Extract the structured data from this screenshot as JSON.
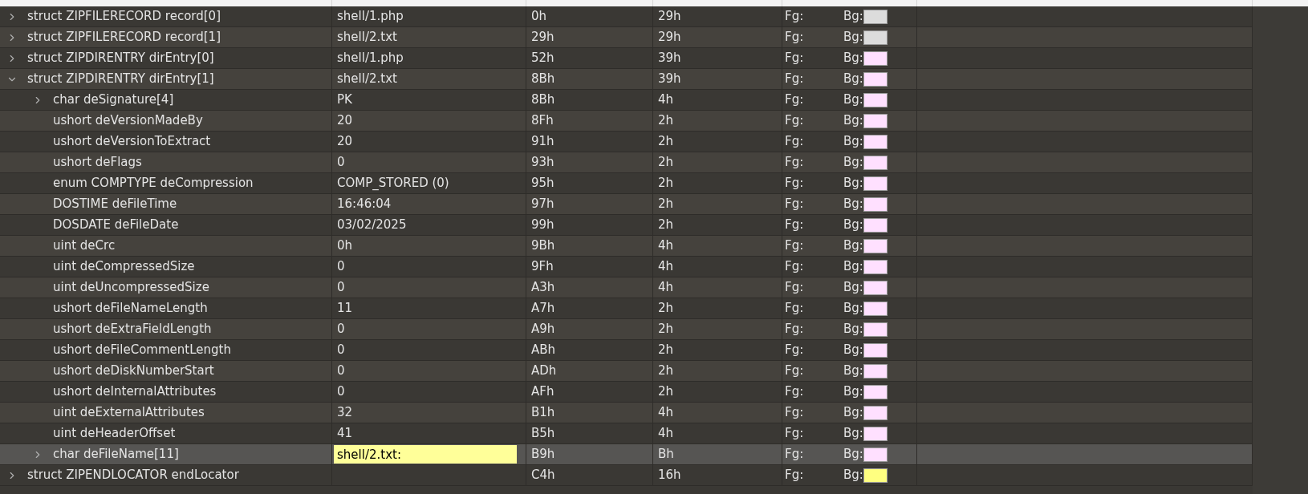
{
  "rows": [
    {
      "name": "struct ZIPFILERECORD record[0]",
      "value": "shell/1.php",
      "start": "0h",
      "size": "29h",
      "fg": "Fg:",
      "bg": "Bg:",
      "color": "#dcdcdc",
      "expanded": false,
      "selected": false
    },
    {
      "name": "struct ZIPFILERECORD record[1]",
      "value": "shell/2.txt",
      "start": "29h",
      "size": "29h",
      "fg": "Fg:",
      "bg": "Bg:",
      "color": "#dcdcdc",
      "expanded": false,
      "selected": false
    },
    {
      "name": "struct ZIPDIRENTRY dirEntry[0]",
      "value": "shell/1.php",
      "start": "52h",
      "size": "39h",
      "fg": "Fg:",
      "bg": "Bg:",
      "color": "#ffe0ff",
      "expanded": false,
      "selected": false
    },
    {
      "name": "struct ZIPDIRENTRY dirEntry[1]",
      "value": "shell/2.txt",
      "start": "8Bh",
      "size": "39h",
      "fg": "Fg:",
      "bg": "Bg:",
      "color": "#ffe0ff",
      "expanded": true,
      "selected": false,
      "children": [
        {
          "name": "char deSignature[4]",
          "value": "PK",
          "start": "8Bh",
          "size": "4h",
          "fg": "Fg:",
          "bg": "Bg:",
          "color": "#ffe0ff",
          "expanded": false,
          "selected": false
        },
        {
          "name": "ushort deVersionMadeBy",
          "value": "20",
          "start": "8Fh",
          "size": "2h",
          "fg": "Fg:",
          "bg": "Bg:",
          "color": "#ffe0ff",
          "selected": false
        },
        {
          "name": "ushort deVersionToExtract",
          "value": "20",
          "start": "91h",
          "size": "2h",
          "fg": "Fg:",
          "bg": "Bg:",
          "color": "#ffe0ff",
          "selected": false
        },
        {
          "name": "ushort deFlags",
          "value": "0",
          "start": "93h",
          "size": "2h",
          "fg": "Fg:",
          "bg": "Bg:",
          "color": "#ffe0ff",
          "selected": false
        },
        {
          "name": "enum COMPTYPE deCompression",
          "value": "COMP_STORED (0)",
          "start": "95h",
          "size": "2h",
          "fg": "Fg:",
          "bg": "Bg:",
          "color": "#ffe0ff",
          "selected": false
        },
        {
          "name": "DOSTIME deFileTime",
          "value": "16:46:04",
          "start": "97h",
          "size": "2h",
          "fg": "Fg:",
          "bg": "Bg:",
          "color": "#ffe0ff",
          "selected": false
        },
        {
          "name": "DOSDATE deFileDate",
          "value": "03/02/2025",
          "start": "99h",
          "size": "2h",
          "fg": "Fg:",
          "bg": "Bg:",
          "color": "#ffe0ff",
          "selected": false
        },
        {
          "name": "uint deCrc",
          "value": "0h",
          "start": "9Bh",
          "size": "4h",
          "fg": "Fg:",
          "bg": "Bg:",
          "color": "#ffe0ff",
          "selected": false
        },
        {
          "name": "uint deCompressedSize",
          "value": "0",
          "start": "9Fh",
          "size": "4h",
          "fg": "Fg:",
          "bg": "Bg:",
          "color": "#ffe0ff",
          "selected": false
        },
        {
          "name": "uint deUncompressedSize",
          "value": "0",
          "start": "A3h",
          "size": "4h",
          "fg": "Fg:",
          "bg": "Bg:",
          "color": "#ffe0ff",
          "selected": false
        },
        {
          "name": "ushort deFileNameLength",
          "value": "11",
          "start": "A7h",
          "size": "2h",
          "fg": "Fg:",
          "bg": "Bg:",
          "color": "#ffe0ff",
          "selected": false
        },
        {
          "name": "ushort deExtraFieldLength",
          "value": "0",
          "start": "A9h",
          "size": "2h",
          "fg": "Fg:",
          "bg": "Bg:",
          "color": "#ffe0ff",
          "selected": false
        },
        {
          "name": "ushort deFileCommentLength",
          "value": "0",
          "start": "ABh",
          "size": "2h",
          "fg": "Fg:",
          "bg": "Bg:",
          "color": "#ffe0ff",
          "selected": false
        },
        {
          "name": "ushort deDiskNumberStart",
          "value": "0",
          "start": "ADh",
          "size": "2h",
          "fg": "Fg:",
          "bg": "Bg:",
          "color": "#ffe0ff",
          "selected": false
        },
        {
          "name": "ushort deInternalAttributes",
          "value": "0",
          "start": "AFh",
          "size": "2h",
          "fg": "Fg:",
          "bg": "Bg:",
          "color": "#ffe0ff",
          "selected": false
        },
        {
          "name": "uint deExternalAttributes",
          "value": "32",
          "start": "B1h",
          "size": "4h",
          "fg": "Fg:",
          "bg": "Bg:",
          "color": "#ffe0ff",
          "selected": false
        },
        {
          "name": "uint deHeaderOffset",
          "value": "41",
          "start": "B5h",
          "size": "4h",
          "fg": "Fg:",
          "bg": "Bg:",
          "color": "#ffe0ff",
          "selected": false
        },
        {
          "name": "char deFileName[11]",
          "value": "shell/2.txt:",
          "start": "B9h",
          "size": "Bh",
          "fg": "Fg:",
          "bg": "Bg:",
          "color": "#ffe0ff",
          "expanded": false,
          "selected": true
        }
      ]
    },
    {
      "name": "struct ZIPENDLOCATOR endLocator",
      "start": "C4h",
      "size": "16h",
      "fg": "Fg:",
      "bg": "Bg:",
      "color": "#ffff80",
      "expanded": false,
      "selected": false
    }
  ]
}
